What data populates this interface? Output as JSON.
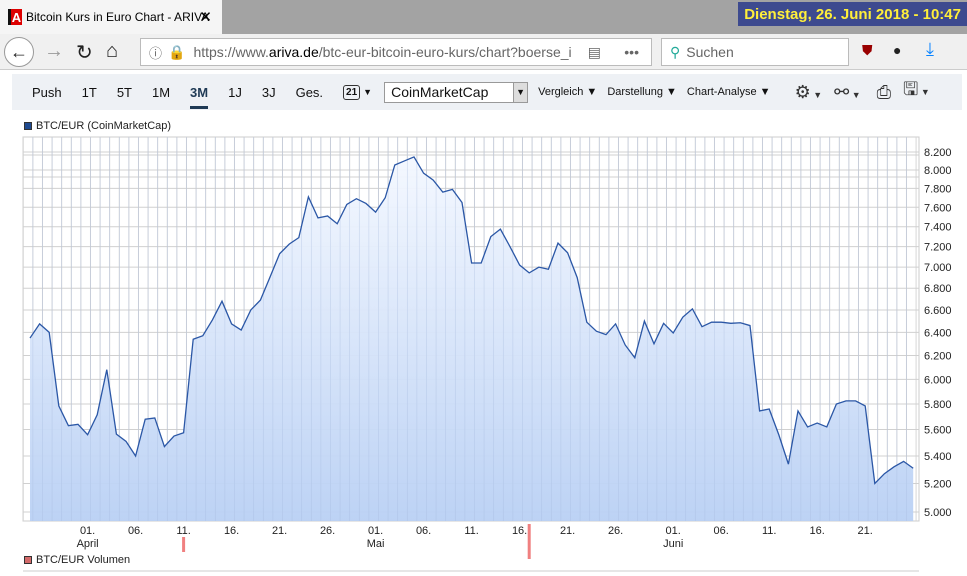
{
  "browser": {
    "tab_title": "Bitcoin Kurs in Euro Chart - ARIVA",
    "tab_logo": "A",
    "datetime": "Dienstag, 26. Juni 2018 - 10:47",
    "url_prefix": "https://www.",
    "url_domain": "ariva.de",
    "url_rest": "/btc-eur-bitcoin-euro-kurs/chart?boerse_i",
    "search_placeholder": "Suchen"
  },
  "toolbar": {
    "ranges": [
      "Push",
      "1T",
      "5T",
      "1M",
      "3M",
      "1J",
      "3J",
      "Ges."
    ],
    "active": "3M",
    "calendar_day": "21",
    "source": "CoinMarketCap",
    "menus": [
      "Vergleich",
      "Darstellung",
      "Chart-Analyse"
    ]
  },
  "chart_data": {
    "type": "area",
    "title": "BTC/EUR (CoinMarketCap)",
    "secondary_legend": "BTC/EUR Volumen",
    "yscale": "log",
    "ylim": [
      5000,
      8200
    ],
    "y_ticks": [
      8200,
      8000,
      7800,
      7600,
      7400,
      7200,
      7000,
      6800,
      6600,
      6400,
      6200,
      6000,
      5800,
      5600,
      5400,
      5200,
      5000
    ],
    "y_tick_labels": [
      "8.200",
      "8.000",
      "7.800",
      "7.600",
      "7.400",
      "7.200",
      "7.000",
      "6.800",
      "6.600",
      "6.400",
      "6.200",
      "6.000",
      "5.800",
      "5.600",
      "5.400",
      "5.200",
      "5.000"
    ],
    "x_start": "2018-03-26",
    "x_end": "2018-06-26",
    "x_ticks": [
      {
        "label": "01.",
        "day": 6
      },
      {
        "label": "06.",
        "day": 11
      },
      {
        "label": "11.",
        "day": 16
      },
      {
        "label": "16.",
        "day": 21
      },
      {
        "label": "21.",
        "day": 26
      },
      {
        "label": "26.",
        "day": 31
      },
      {
        "label": "01.",
        "day": 36
      },
      {
        "label": "06.",
        "day": 41
      },
      {
        "label": "11.",
        "day": 46
      },
      {
        "label": "16.",
        "day": 51
      },
      {
        "label": "21.",
        "day": 56
      },
      {
        "label": "26.",
        "day": 61
      },
      {
        "label": "01.",
        "day": 67
      },
      {
        "label": "06.",
        "day": 72
      },
      {
        "label": "11.",
        "day": 77
      },
      {
        "label": "16.",
        "day": 82
      },
      {
        "label": "21.",
        "day": 87
      }
    ],
    "month_labels": [
      {
        "label": "April",
        "day": 6
      },
      {
        "label": "Mai",
        "day": 36
      },
      {
        "label": "Juni",
        "day": 67
      }
    ],
    "markers": [
      16,
      52
    ],
    "values": [
      6350,
      6475,
      6400,
      5785,
      5630,
      5640,
      5560,
      5715,
      6080,
      5565,
      5510,
      5400,
      5680,
      5690,
      5470,
      5550,
      5575,
      6340,
      6370,
      6510,
      6680,
      6475,
      6420,
      6600,
      6690,
      6905,
      7130,
      7225,
      7290,
      7710,
      7490,
      7510,
      7430,
      7630,
      7690,
      7640,
      7550,
      7700,
      8055,
      8100,
      8145,
      7965,
      7890,
      7760,
      7790,
      7650,
      7040,
      7040,
      7300,
      7375,
      7200,
      7020,
      6945,
      7000,
      6980,
      7235,
      7140,
      6900,
      6490,
      6410,
      6380,
      6475,
      6290,
      6180,
      6500,
      6300,
      6480,
      6395,
      6535,
      6610,
      6450,
      6490,
      6490,
      6480,
      6485,
      6460,
      5745,
      5760,
      5560,
      5340,
      5745,
      5620,
      5650,
      5620,
      5800,
      5825,
      5825,
      5785,
      5200,
      5270,
      5320,
      5360,
      5310
    ],
    "colors": {
      "line": "#2b57a6",
      "fill_top": "#f4f8ff",
      "fill_bottom": "#b9d0f4",
      "marker": "#f08080"
    }
  }
}
